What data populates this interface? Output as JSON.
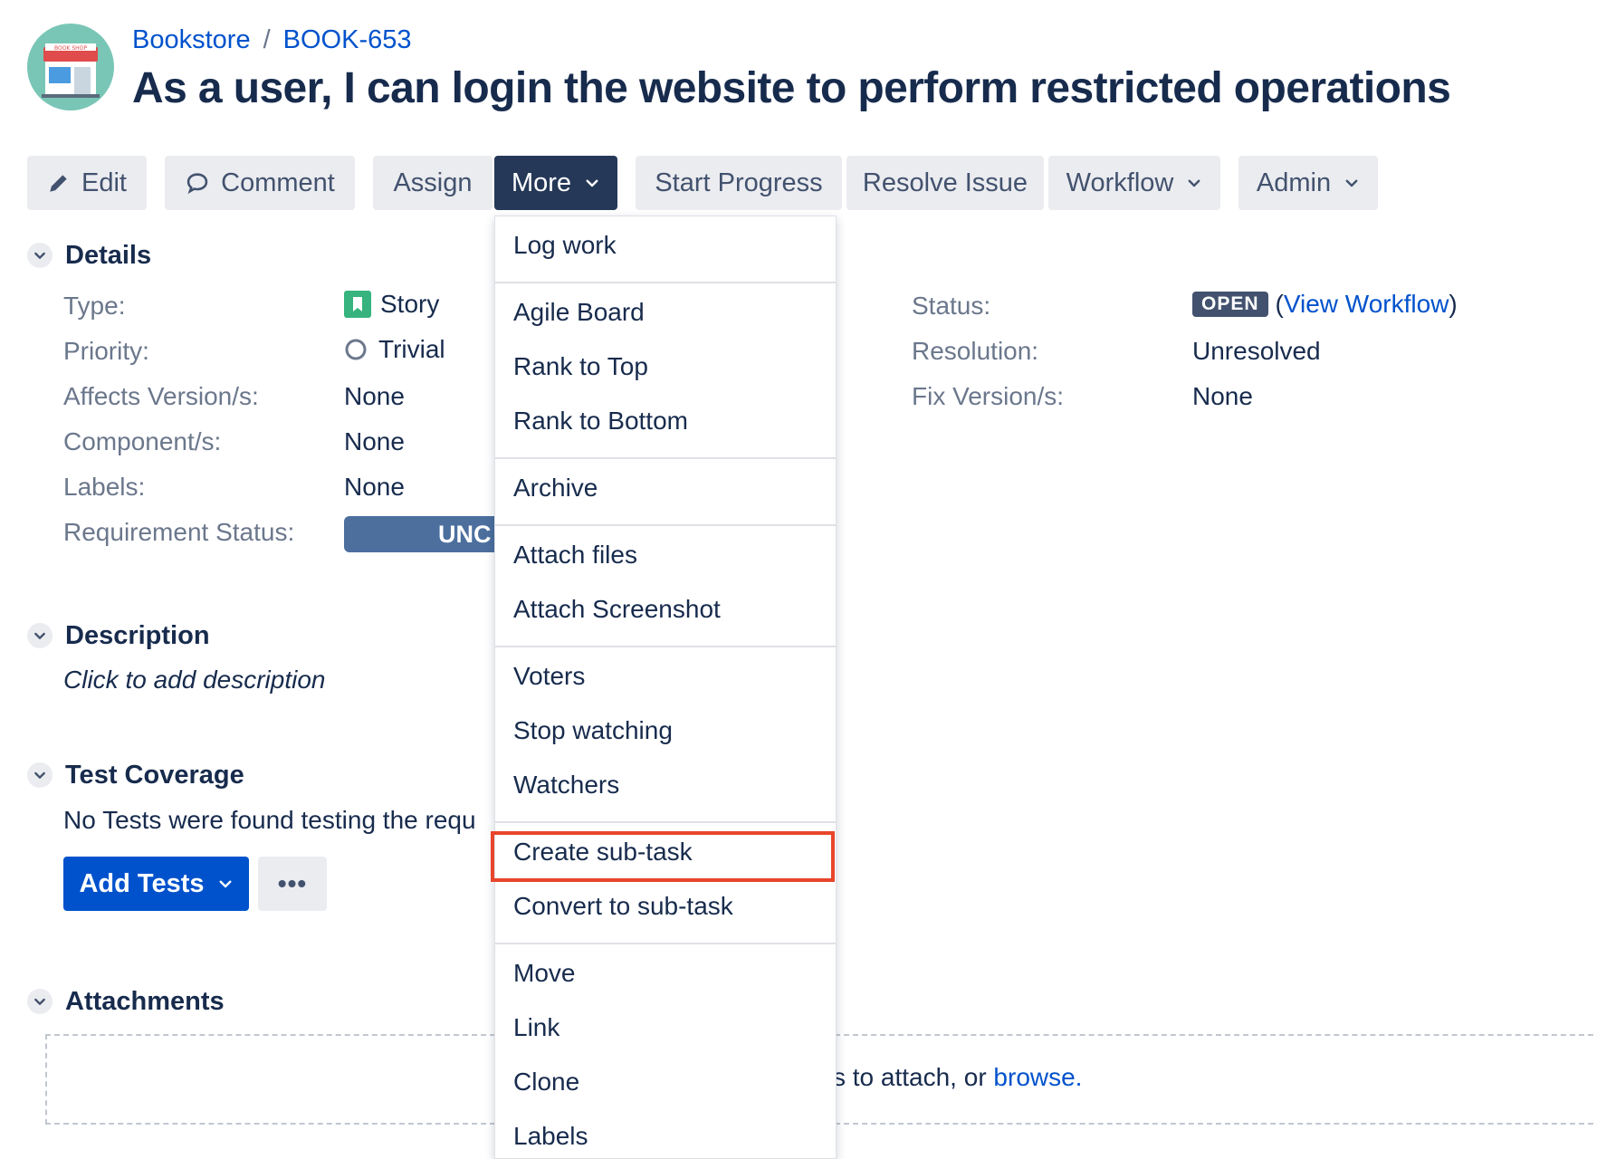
{
  "breadcrumb": {
    "project": "Bookstore",
    "separator": "/",
    "issue_key": "BOOK-653"
  },
  "issue": {
    "title": "As a user, I can login the website to perform restricted operations"
  },
  "avatar": {
    "icon": "bookshop-icon",
    "sign_text": "BOOK SHOP"
  },
  "toolbar": {
    "edit": "Edit",
    "comment": "Comment",
    "assign": "Assign",
    "more": "More",
    "start_progress": "Start Progress",
    "resolve_issue": "Resolve Issue",
    "workflow": "Workflow",
    "admin": "Admin"
  },
  "details": {
    "heading": "Details",
    "type_label": "Type:",
    "type_value": "Story",
    "priority_label": "Priority:",
    "priority_value": "Trivial",
    "affects_label": "Affects Version/s:",
    "affects_value": "None",
    "components_label": "Component/s:",
    "components_value": "None",
    "labels_label": "Labels:",
    "labels_value": "None",
    "requirement_label": "Requirement Status:",
    "requirement_value": "UNC",
    "status_label": "Status:",
    "status_value": "OPEN",
    "view_workflow_open": "(",
    "view_workflow": "View Workflow",
    "view_workflow_close": ")",
    "resolution_label": "Resolution:",
    "resolution_value": "Unresolved",
    "fix_label": "Fix Version/s:",
    "fix_value": "None"
  },
  "description": {
    "heading": "Description",
    "placeholder": "Click to add description"
  },
  "test_coverage": {
    "heading": "Test Coverage",
    "text": "No Tests were found testing the requ",
    "add_tests": "Add Tests",
    "more": "•••"
  },
  "attachments": {
    "heading": "Attachments",
    "drop_text_prefix": "s to attach, or ",
    "browse": "browse."
  },
  "more_menu": {
    "log_work": "Log work",
    "agile_board": "Agile Board",
    "rank_top": "Rank to Top",
    "rank_bottom": "Rank to Bottom",
    "archive": "Archive",
    "attach_files": "Attach files",
    "attach_screenshot": "Attach Screenshot",
    "voters": "Voters",
    "stop_watching": "Stop watching",
    "watchers": "Watchers",
    "create_subtask": "Create sub-task",
    "convert_subtask": "Convert to sub-task",
    "move": "Move",
    "link": "Link",
    "clone": "Clone",
    "labels": "Labels"
  },
  "colors": {
    "accent": "#0052CC",
    "more_active": "#253858",
    "highlight": "#E8452C",
    "story": "#36B37E"
  }
}
